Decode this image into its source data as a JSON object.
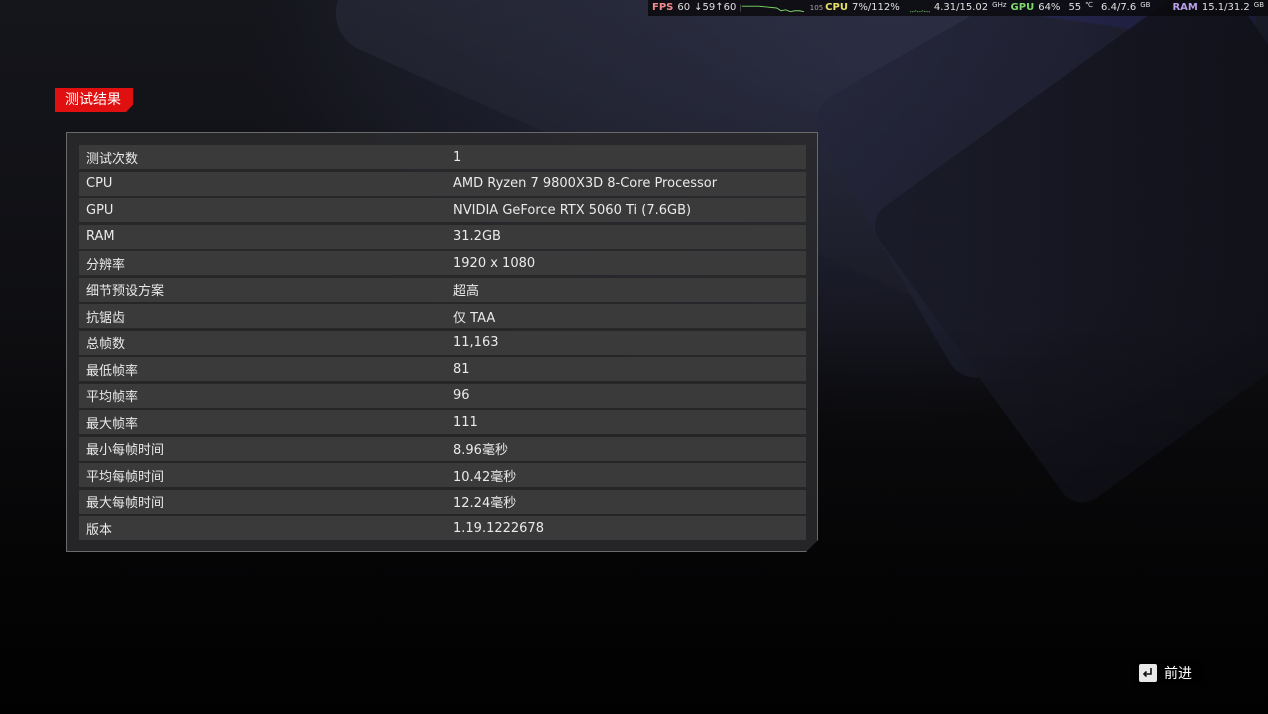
{
  "hud": {
    "fps_label": "FPS",
    "fps_value": "60",
    "fps_range": "↓59↑60",
    "frametime_graph_label": "105",
    "cpu_label": "CPU",
    "cpu_value": "7%/112%",
    "cpu_clock": "4.31/15.02",
    "cpu_clock_unit": "GHz",
    "gpu_label": "GPU",
    "gpu_value": "64%",
    "gpu_temp": "55",
    "gpu_temp_unit": "℃",
    "vram": "6.4/7.6",
    "vram_unit": "GB",
    "ram_label": "RAM",
    "ram_value": "15.1/31.2",
    "ram_unit": "GB",
    "colors": {
      "fps": "#f08c8c",
      "cpu": "#e8e26a",
      "gpu": "#7ed96a",
      "ram": "#b89ee8"
    }
  },
  "title": "测试结果",
  "results": [
    {
      "label": "测试次数",
      "value": "1"
    },
    {
      "label": "CPU",
      "value": "AMD Ryzen 7 9800X3D 8-Core Processor"
    },
    {
      "label": "GPU",
      "value": "NVIDIA GeForce RTX 5060 Ti (7.6GB)"
    },
    {
      "label": "RAM",
      "value": "31.2GB"
    },
    {
      "label": "分辨率",
      "value": "1920 x 1080"
    },
    {
      "label": "细节预设方案",
      "value": "超高"
    },
    {
      "label": "抗锯齿",
      "value": "仅 TAA"
    },
    {
      "label": "总帧数",
      "value": "11,163"
    },
    {
      "label": "最低帧率",
      "value": "81"
    },
    {
      "label": "平均帧率",
      "value": "96"
    },
    {
      "label": "最大帧率",
      "value": "111"
    },
    {
      "label": "最小每帧时间",
      "value": "8.96毫秒"
    },
    {
      "label": "平均每帧时间",
      "value": "10.42毫秒"
    },
    {
      "label": "最大每帧时间",
      "value": "12.24毫秒"
    },
    {
      "label": "版本",
      "value": "1.19.1222678"
    }
  ],
  "footer": {
    "next_label": "前进",
    "next_key_icon": "enter-key-icon"
  },
  "colors": {
    "accent": "#e01010",
    "panel": "#2a2a2c",
    "row": "#3a3a3b"
  }
}
